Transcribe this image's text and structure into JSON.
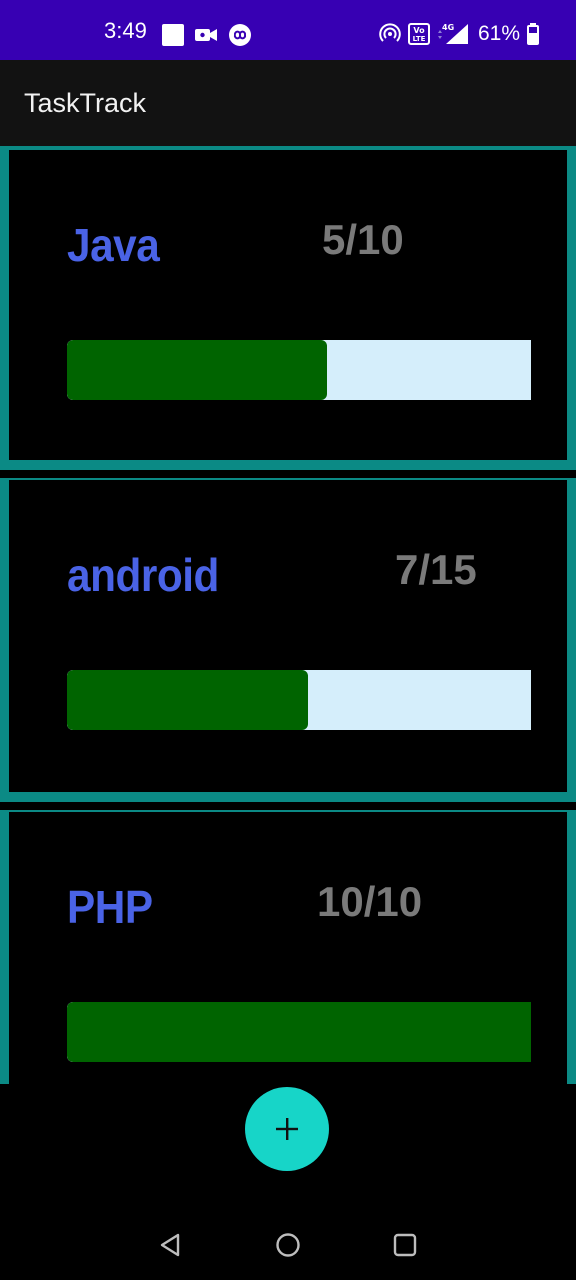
{
  "status_bar": {
    "time": "3:49",
    "battery": "61%",
    "icons_left": [
      "square-notification-icon",
      "video-camera-icon",
      "sync-loop-icon"
    ],
    "icons_right": [
      "hotspot-icon",
      "volte-icon",
      "4g-signal-icon",
      "battery-icon"
    ],
    "background": "#3700b3"
  },
  "app_bar": {
    "title": "TaskTrack",
    "background": "#121212"
  },
  "tasks": [
    {
      "name": "Java",
      "count": "5/10",
      "progress": 0.56
    },
    {
      "name": "android",
      "count": "7/15",
      "progress": 0.52
    },
    {
      "name": "PHP",
      "count": "10/10",
      "progress": 1.0
    }
  ],
  "colors": {
    "card_border": "#0b8a85",
    "task_name": "#4a63e6",
    "task_count": "#7a7a7a",
    "progress_fill": "#006400",
    "progress_track": "#d5eefb",
    "fab": "#17d5c8"
  },
  "fab": {
    "icon": "plus-icon"
  },
  "nav_bar": {
    "icons": [
      "back-icon",
      "home-icon",
      "recents-icon"
    ]
  }
}
